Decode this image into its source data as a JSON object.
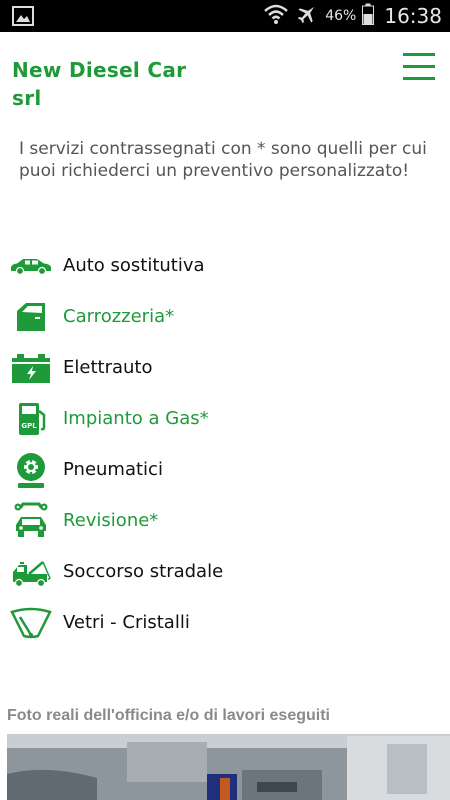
{
  "status_bar": {
    "battery": "46%",
    "time": "16:38"
  },
  "header": {
    "brand_line1": "New Diesel Car",
    "brand_line2": "srl"
  },
  "intro": "I servizi contrassegnati con * sono quelli per cui puoi richiederci un preventivo personalizzato!",
  "services": [
    {
      "label": "Auto sostitutiva",
      "icon": "car-icon",
      "highlight": false
    },
    {
      "label": "Carrozzeria*",
      "icon": "car-door-icon",
      "highlight": true
    },
    {
      "label": "Elettrauto",
      "icon": "battery-icon",
      "highlight": false
    },
    {
      "label": "Impianto a Gas*",
      "icon": "gpl-pump-icon",
      "highlight": true
    },
    {
      "label": "Pneumatici",
      "icon": "tire-icon",
      "highlight": false
    },
    {
      "label": "Revisione*",
      "icon": "car-wrench-icon",
      "highlight": true
    },
    {
      "label": "Soccorso stradale",
      "icon": "tow-truck-icon",
      "highlight": false
    },
    {
      "label": "Vetri - Cristalli",
      "icon": "windshield-icon",
      "highlight": false
    }
  ],
  "photos_title": "Foto reali dell'officina e/o di lavori eseguiti",
  "colors": {
    "accent": "#1f9a3a",
    "text": "#111111",
    "muted": "#555555"
  }
}
